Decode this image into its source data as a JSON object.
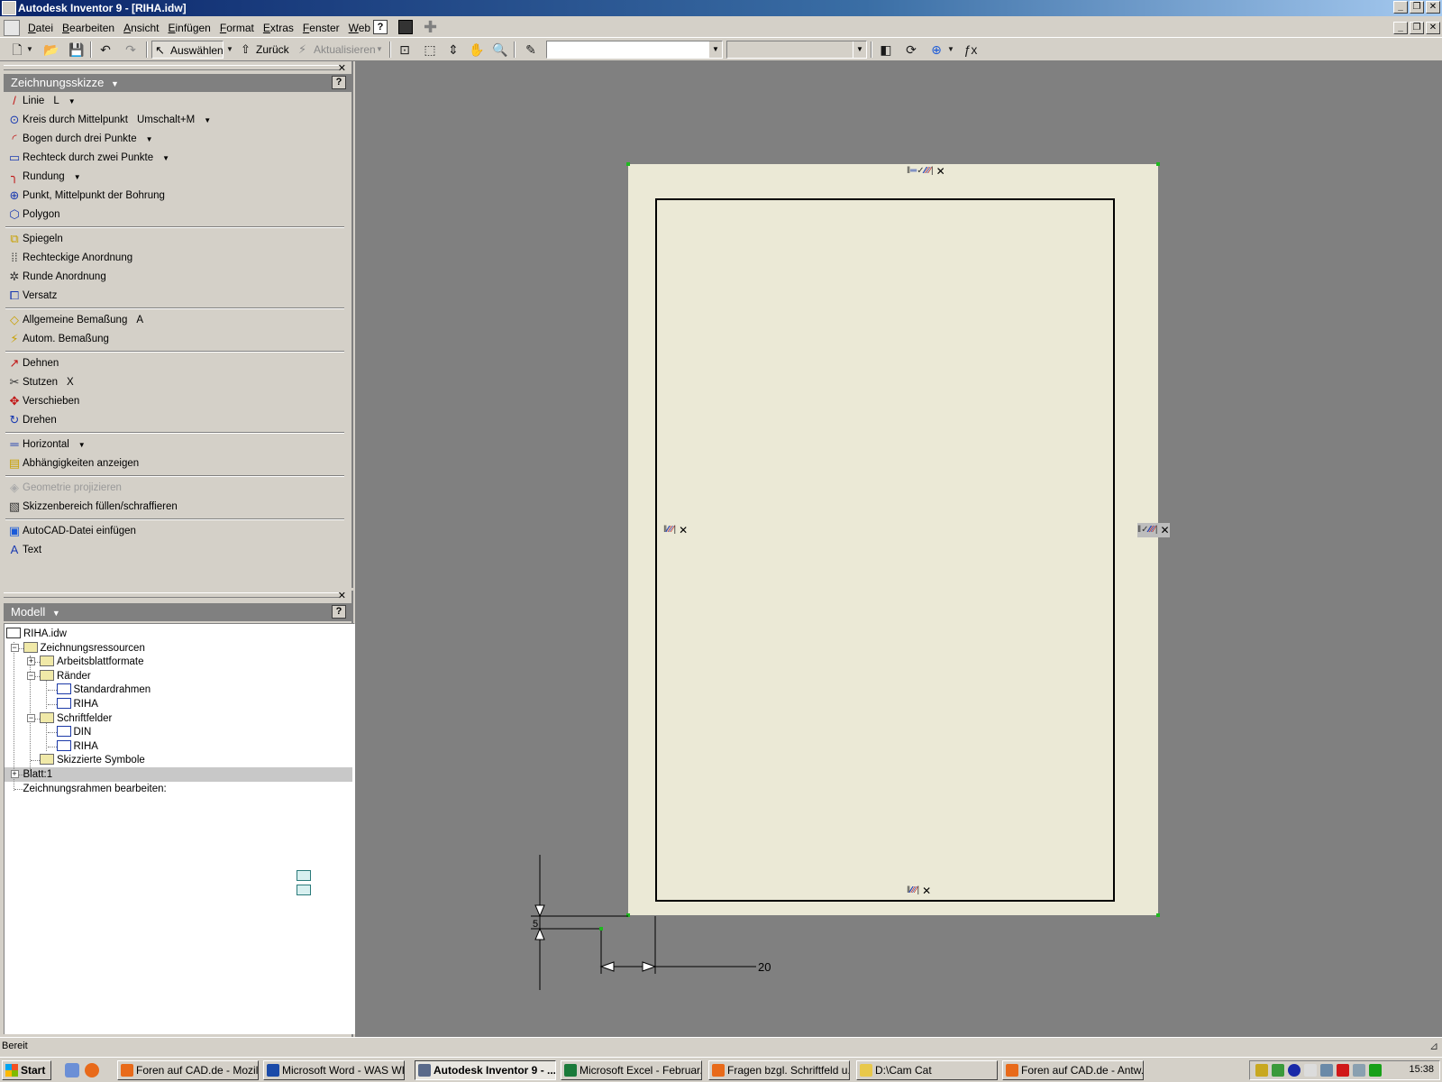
{
  "window": {
    "title": "Autodesk Inventor 9 - [RIHA.idw]",
    "buttons": [
      "_",
      "❐",
      "✕"
    ]
  },
  "menu": {
    "items": [
      {
        "first": "D",
        "rest": "atei"
      },
      {
        "first": "B",
        "rest": "earbeiten"
      },
      {
        "first": "A",
        "rest": "nsicht"
      },
      {
        "first": "E",
        "rest": "infügen"
      },
      {
        "first": "F",
        "rest": "ormat"
      },
      {
        "first": "E",
        "rest": "xtras"
      },
      {
        "first": "F",
        "rest": "enster"
      },
      {
        "first": "W",
        "rest": "eb"
      },
      {
        "first": "?",
        "rest": ""
      }
    ],
    "help_icon": "?"
  },
  "toolbar": {
    "select_label": "Auswählen",
    "back_label": "Zurück",
    "update_label": "Aktualisieren",
    "combo1_value": "",
    "combo2_value": ""
  },
  "sketch_panel": {
    "title": "Zeichnungsskizze",
    "help": "?",
    "tools": [
      {
        "label": "Linie",
        "key": "L",
        "has_menu": true,
        "icon": "line-icon"
      },
      {
        "label": "Kreis durch Mittelpunkt",
        "key": "Umschalt+M",
        "has_menu": true,
        "icon": "circle-icon"
      },
      {
        "label": "Bogen durch drei Punkte",
        "key": "",
        "has_menu": true,
        "icon": "arc-icon"
      },
      {
        "label": "Rechteck durch zwei Punkte",
        "key": "",
        "has_menu": true,
        "icon": "rectangle-icon"
      },
      {
        "label": "Rundung",
        "key": "",
        "has_menu": true,
        "icon": "fillet-icon"
      },
      {
        "label": "Punkt, Mittelpunkt der Bohrung",
        "key": "",
        "has_menu": false,
        "icon": "point-icon"
      },
      {
        "label": "Polygon",
        "key": "",
        "has_menu": false,
        "icon": "polygon-icon"
      },
      {
        "divider": true
      },
      {
        "label": "Spiegeln",
        "key": "",
        "has_menu": false,
        "icon": "mirror-icon"
      },
      {
        "label": "Rechteckige Anordnung",
        "key": "",
        "has_menu": false,
        "icon": "rect-pattern-icon"
      },
      {
        "label": "Runde Anordnung",
        "key": "",
        "has_menu": false,
        "icon": "circ-pattern-icon"
      },
      {
        "label": "Versatz",
        "key": "",
        "has_menu": false,
        "icon": "offset-icon"
      },
      {
        "divider": true
      },
      {
        "label": "Allgemeine Bemaßung",
        "key": "A",
        "has_menu": false,
        "icon": "dimension-icon"
      },
      {
        "label": "Autom. Bemaßung",
        "key": "",
        "has_menu": false,
        "icon": "auto-dimension-icon"
      },
      {
        "divider": true
      },
      {
        "label": "Dehnen",
        "key": "",
        "has_menu": false,
        "icon": "extend-icon"
      },
      {
        "label": "Stutzen",
        "key": "X",
        "has_menu": false,
        "icon": "trim-icon"
      },
      {
        "label": "Verschieben",
        "key": "",
        "has_menu": false,
        "icon": "move-icon"
      },
      {
        "label": "Drehen",
        "key": "",
        "has_menu": false,
        "icon": "rotate-icon"
      },
      {
        "divider": true
      },
      {
        "label": "Horizontal",
        "key": "",
        "has_menu": true,
        "icon": "horizontal-icon"
      },
      {
        "label": "Abhängigkeiten anzeigen",
        "key": "",
        "has_menu": false,
        "icon": "constraints-icon"
      },
      {
        "divider": true
      },
      {
        "label": "Geometrie projizieren",
        "key": "",
        "has_menu": false,
        "icon": "project-icon",
        "disabled": true
      },
      {
        "label": "Skizzenbereich füllen/schraffieren",
        "key": "",
        "has_menu": false,
        "icon": "hatch-icon"
      },
      {
        "divider": true
      },
      {
        "label": "AutoCAD-Datei einfügen",
        "key": "",
        "has_menu": false,
        "icon": "autocad-icon"
      },
      {
        "label": "Text",
        "key": "",
        "has_menu": false,
        "icon": "text-icon"
      }
    ]
  },
  "model_panel": {
    "title": "Modell",
    "help": "?",
    "tree": [
      {
        "label": "RIHA.idw",
        "icon": "drawing-file-icon"
      },
      {
        "label": "Zeichnungsressourcen",
        "icon": "folder-icon"
      },
      {
        "label": "Arbeitsblattformate",
        "icon": "folder-icon"
      },
      {
        "label": "Ränder",
        "icon": "folder-icon"
      },
      {
        "label": "Standardrahmen",
        "icon": "border-icon"
      },
      {
        "label": "RIHA",
        "icon": "border-icon"
      },
      {
        "label": "Schriftfelder",
        "icon": "folder-icon"
      },
      {
        "label": "DIN",
        "icon": "title-block-icon"
      },
      {
        "label": "RIHA",
        "icon": "title-block-icon"
      },
      {
        "label": "Skizzierte Symbole",
        "icon": "folder-icon"
      },
      {
        "label": "Blatt:1",
        "icon": "sheet-icon"
      },
      {
        "label": "Zeichnungsrahmen bearbeiten:",
        "icon": "sheet-icon"
      }
    ]
  },
  "canvas": {
    "dimension_value": "20",
    "dimension_small": "5",
    "colors": {
      "background": "#808080",
      "sheet": "#ebe9d6",
      "corner": "#1fb81f"
    }
  },
  "status": {
    "text": "Bereit"
  },
  "taskbar": {
    "start": "Start",
    "tasks": [
      {
        "label": "Foren auf CAD.de - Mozill...",
        "icon": "firefox-icon",
        "active": false
      },
      {
        "label": "Microsoft Word - WAS WI...",
        "icon": "word-icon",
        "active": false
      },
      {
        "label": "Autodesk Inventor 9 - ...",
        "icon": "inventor-icon",
        "active": true
      },
      {
        "label": "Microsoft Excel - Februar...",
        "icon": "excel-icon",
        "active": false
      },
      {
        "label": "Fragen bzgl. Schriftfeld u...",
        "icon": "firefox-icon",
        "active": false
      },
      {
        "label": "D:\\Cam Cat",
        "icon": "folder-icon",
        "active": false
      },
      {
        "label": "Foren auf CAD.de - Antw...",
        "icon": "firefox-icon",
        "active": false
      }
    ],
    "clock": "15:38"
  }
}
